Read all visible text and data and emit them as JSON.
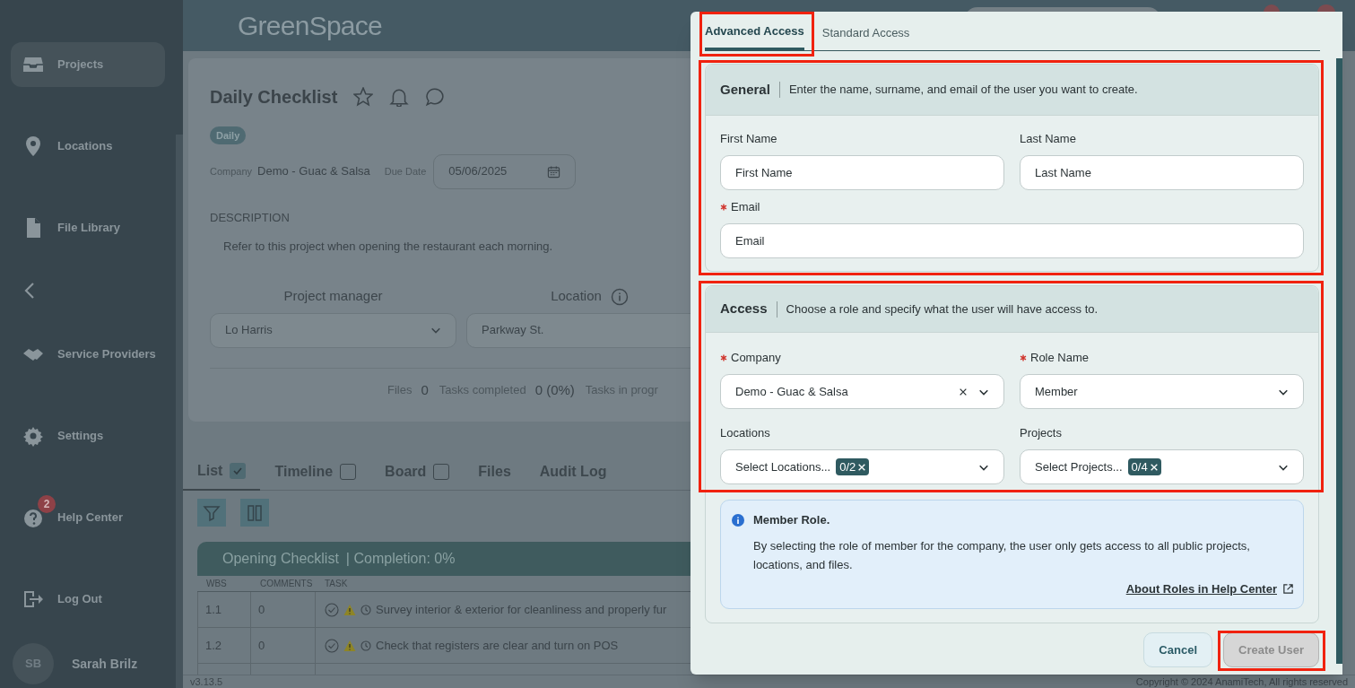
{
  "sidebar": {
    "items": [
      {
        "label": "Projects",
        "selected": true
      },
      {
        "label": "Locations",
        "selected": false
      },
      {
        "label": "File Library",
        "selected": false
      },
      {
        "label": "Service Providers",
        "selected": false
      },
      {
        "label": "Settings",
        "selected": false
      },
      {
        "label": "Help Center",
        "selected": false,
        "badge": "2"
      },
      {
        "label": "Log Out",
        "selected": false
      }
    ],
    "user": {
      "initials": "SB",
      "name": "Sarah Brilz"
    }
  },
  "header": {
    "logo": "GreenSpace"
  },
  "project": {
    "title": "Daily Checklist",
    "tag": "Daily",
    "company_label": "Company",
    "company": "Demo - Guac & Salsa",
    "due_date_label": "Due Date",
    "due_date": "05/06/2025",
    "description_label": "DESCRIPTION",
    "description": "Refer to this project when opening the restaurant each morning.",
    "manager_label": "Project manager",
    "manager": "Lo Harris",
    "location_label": "Location",
    "location": "Parkway St.",
    "stats": [
      {
        "label": "Files",
        "value": "0"
      },
      {
        "label": "Tasks completed",
        "value": "0 (0%)"
      },
      {
        "label": "Tasks in progr"
      }
    ]
  },
  "view_tabs": [
    {
      "label": "List",
      "selected": true,
      "kind": "checkbox",
      "checked": true
    },
    {
      "label": "Timeline",
      "selected": false,
      "kind": "checkbox",
      "checked": false
    },
    {
      "label": "Board",
      "selected": false,
      "kind": "checkbox",
      "checked": false
    },
    {
      "label": "Files",
      "selected": false,
      "kind": "plain"
    },
    {
      "label": "Audit Log",
      "selected": false,
      "kind": "plain"
    }
  ],
  "task_table": {
    "title": "Opening Checklist",
    "completion": "| Completion: 0%",
    "columns": [
      "WBS",
      "COMMENTS",
      "TASK"
    ],
    "rows": [
      {
        "wbs": "1.1",
        "comments": "0",
        "task": "Survey interior & exterior for cleanliness and properly fur"
      },
      {
        "wbs": "1.2",
        "comments": "0",
        "task": "Check that registers are clear and turn on POS"
      }
    ]
  },
  "footer": {
    "version": "v3.13.5",
    "copyright": "Copyright © 2024 AnamiTech, All rights reserved"
  },
  "dialog": {
    "tabs": [
      {
        "label": "Advanced Access",
        "selected": true,
        "highlighted": true
      },
      {
        "label": "Standard Access",
        "selected": false,
        "highlighted": false
      }
    ],
    "sections": [
      {
        "title": "General",
        "description": "Enter the name, surname, and email of the user you want to create.",
        "highlighted": true,
        "fields": [
          {
            "label": "First Name",
            "required": false,
            "kind": "input",
            "placeholder": "First Name"
          },
          {
            "label": "Last Name",
            "required": false,
            "kind": "input",
            "placeholder": "Last Name"
          },
          {
            "label": "Email",
            "required": true,
            "kind": "input",
            "placeholder": "Email",
            "wide": true
          }
        ]
      },
      {
        "title": "Access",
        "description": "Choose a role and specify what the user will have access to.",
        "highlighted": true,
        "fields": [
          {
            "label": "Company",
            "required": true,
            "kind": "select",
            "value": "Demo - Guac & Salsa",
            "clearable": true
          },
          {
            "label": "Role Name",
            "required": true,
            "kind": "select",
            "value": "Member",
            "clearable": false
          },
          {
            "label": "Locations",
            "required": false,
            "kind": "multiselect",
            "placeholder": "Select Locations...",
            "count": "0/2"
          },
          {
            "label": "Projects",
            "required": false,
            "kind": "multiselect",
            "placeholder": "Select Projects...",
            "count": "0/4"
          }
        ],
        "info": {
          "title": "Member Role.",
          "text": "By selecting the role of member for the company, the user only gets access to all public projects, locations, and files.",
          "link": "About Roles in Help Center"
        }
      }
    ],
    "buttons": [
      {
        "label": "Cancel",
        "kind": "secondary",
        "disabled": false,
        "highlighted": false
      },
      {
        "label": "Create User",
        "kind": "primary",
        "disabled": true,
        "highlighted": true
      }
    ]
  }
}
